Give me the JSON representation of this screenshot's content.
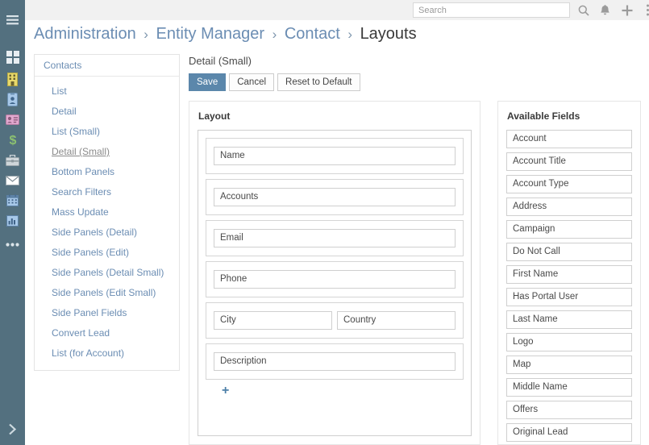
{
  "rail": {
    "menu_label": "Menu",
    "items": [
      {
        "name": "dashboard",
        "icon": "grid-icon",
        "color": "#e8eef2"
      },
      {
        "name": "accounts",
        "icon": "building-icon",
        "color": "#e8d96b"
      },
      {
        "name": "contacts",
        "icon": "id-card-icon",
        "color": "#a7c8e8"
      },
      {
        "name": "leads",
        "icon": "contact-card-icon",
        "color": "#e2a9cf"
      },
      {
        "name": "opportunities",
        "icon": "dollar-icon",
        "color": "#8cc070"
      },
      {
        "name": "cases",
        "icon": "briefcase-icon",
        "color": "#cfd6da"
      },
      {
        "name": "emails",
        "icon": "envelope-icon",
        "color": "#ffffff"
      },
      {
        "name": "calendar",
        "icon": "calendar-icon",
        "color": "#a7c8e8"
      },
      {
        "name": "reports",
        "icon": "chart-bars-icon",
        "color": "#a7c8e8"
      },
      {
        "name": "more",
        "icon": "ellipsis-icon",
        "color": "#e8eef2"
      }
    ],
    "expand_icon": "chevron-right-icon"
  },
  "topbar": {
    "search": {
      "placeholder": "Search",
      "value": ""
    },
    "icons": [
      {
        "name": "search-icon",
        "label": "Search"
      },
      {
        "name": "bell-icon",
        "label": "Notifications"
      },
      {
        "name": "plus-icon",
        "label": "Create"
      },
      {
        "name": "ellipsis-vertical-icon",
        "label": "More"
      }
    ]
  },
  "breadcrumb": {
    "separator": "›",
    "items": [
      {
        "label": "Administration",
        "current": false
      },
      {
        "label": "Entity Manager",
        "current": false
      },
      {
        "label": "Contact",
        "current": false
      },
      {
        "label": "Layouts",
        "current": true
      }
    ]
  },
  "sidepanel": {
    "header": "Contacts",
    "items": [
      {
        "label": "List",
        "active": false
      },
      {
        "label": "Detail",
        "active": false
      },
      {
        "label": "List (Small)",
        "active": false
      },
      {
        "label": "Detail (Small)",
        "active": true
      },
      {
        "label": "Bottom Panels",
        "active": false
      },
      {
        "label": "Search Filters",
        "active": false
      },
      {
        "label": "Mass Update",
        "active": false
      },
      {
        "label": "Side Panels (Detail)",
        "active": false
      },
      {
        "label": "Side Panels (Edit)",
        "active": false
      },
      {
        "label": "Side Panels (Detail Small)",
        "active": false
      },
      {
        "label": "Side Panels (Edit Small)",
        "active": false
      },
      {
        "label": "Side Panel Fields",
        "active": false
      },
      {
        "label": "Convert Lead",
        "active": false
      },
      {
        "label": "List (for Account)",
        "active": false
      }
    ]
  },
  "main": {
    "title": "Detail (Small)",
    "buttons": [
      {
        "label": "Save",
        "style": "primary"
      },
      {
        "label": "Cancel",
        "style": "default"
      },
      {
        "label": "Reset to Default",
        "style": "default"
      }
    ],
    "layout": {
      "title": "Layout",
      "rows": [
        {
          "cells": [
            "Name"
          ]
        },
        {
          "cells": [
            "Accounts"
          ]
        },
        {
          "cells": [
            "Email"
          ]
        },
        {
          "cells": [
            "Phone"
          ]
        },
        {
          "cells": [
            "City",
            "Country"
          ]
        },
        {
          "cells": [
            "Description"
          ]
        }
      ],
      "add_row_label": "+"
    },
    "available_fields": {
      "title": "Available Fields",
      "items": [
        "Account",
        "Account Title",
        "Account Type",
        "Address",
        "Campaign",
        "Do Not Call",
        "First Name",
        "Has Portal User",
        "Last Name",
        "Logo",
        "Map",
        "Middle Name",
        "Offers",
        "Original Lead"
      ]
    }
  },
  "colors": {
    "rail_bg": "#53707f",
    "primary": "#5b87ab",
    "link": "#6b8db3",
    "topbar_bg": "#f1f1f1"
  }
}
